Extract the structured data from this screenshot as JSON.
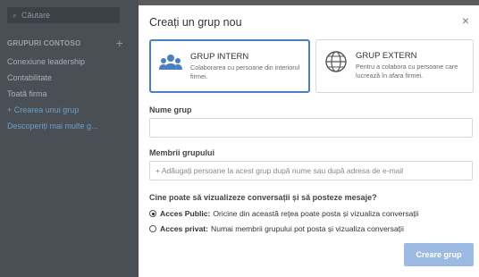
{
  "sidebar": {
    "search_placeholder": "Căutare",
    "groups_header": "GRUPURI CONTOSO",
    "add_symbol": "+",
    "items": [
      {
        "label": "Conexiune leadership",
        "accent": false
      },
      {
        "label": "Contabilitate",
        "accent": false
      },
      {
        "label": "Toată firma",
        "accent": false
      },
      {
        "label": "+ Crearea unui grup",
        "accent": true
      },
      {
        "label": "Descoperiți mai multe g...",
        "accent": true
      }
    ]
  },
  "modal": {
    "title": "Creați un grup nou",
    "close_symbol": "×",
    "cards": {
      "internal": {
        "title": "GRUP INTERN",
        "description": "Colaborarea cu persoane din interiorul firmei.",
        "icon": "people-icon"
      },
      "external": {
        "title": "GRUP EXTERN",
        "description": "Pentru a colabora cu persoane care lucrează în afara firmei.",
        "icon": "globe-icon"
      }
    },
    "group_name_label": "Nume grup",
    "group_name_value": "",
    "members_label": "Membrii grupului",
    "members_placeholder": "+ Adăugați persoane la acest grup după nume sau după adresa de e-mail",
    "visibility_question": "Cine poate să vizualizeze conversații și să posteze mesaje?",
    "options": [
      {
        "bold": "Acces Public:",
        "text": "Oricine din această rețea poate posta și vizualiza conversații",
        "selected": true
      },
      {
        "bold": "Acces privat:",
        "text": "Numai membrii grupului pot posta și vizualiza conversații",
        "selected": false
      }
    ],
    "create_button": "Creare grup"
  },
  "colors": {
    "accent": "#4a7fc1",
    "button_disabled": "#9dbbe2",
    "sidebar_bg": "#4a4f55"
  }
}
